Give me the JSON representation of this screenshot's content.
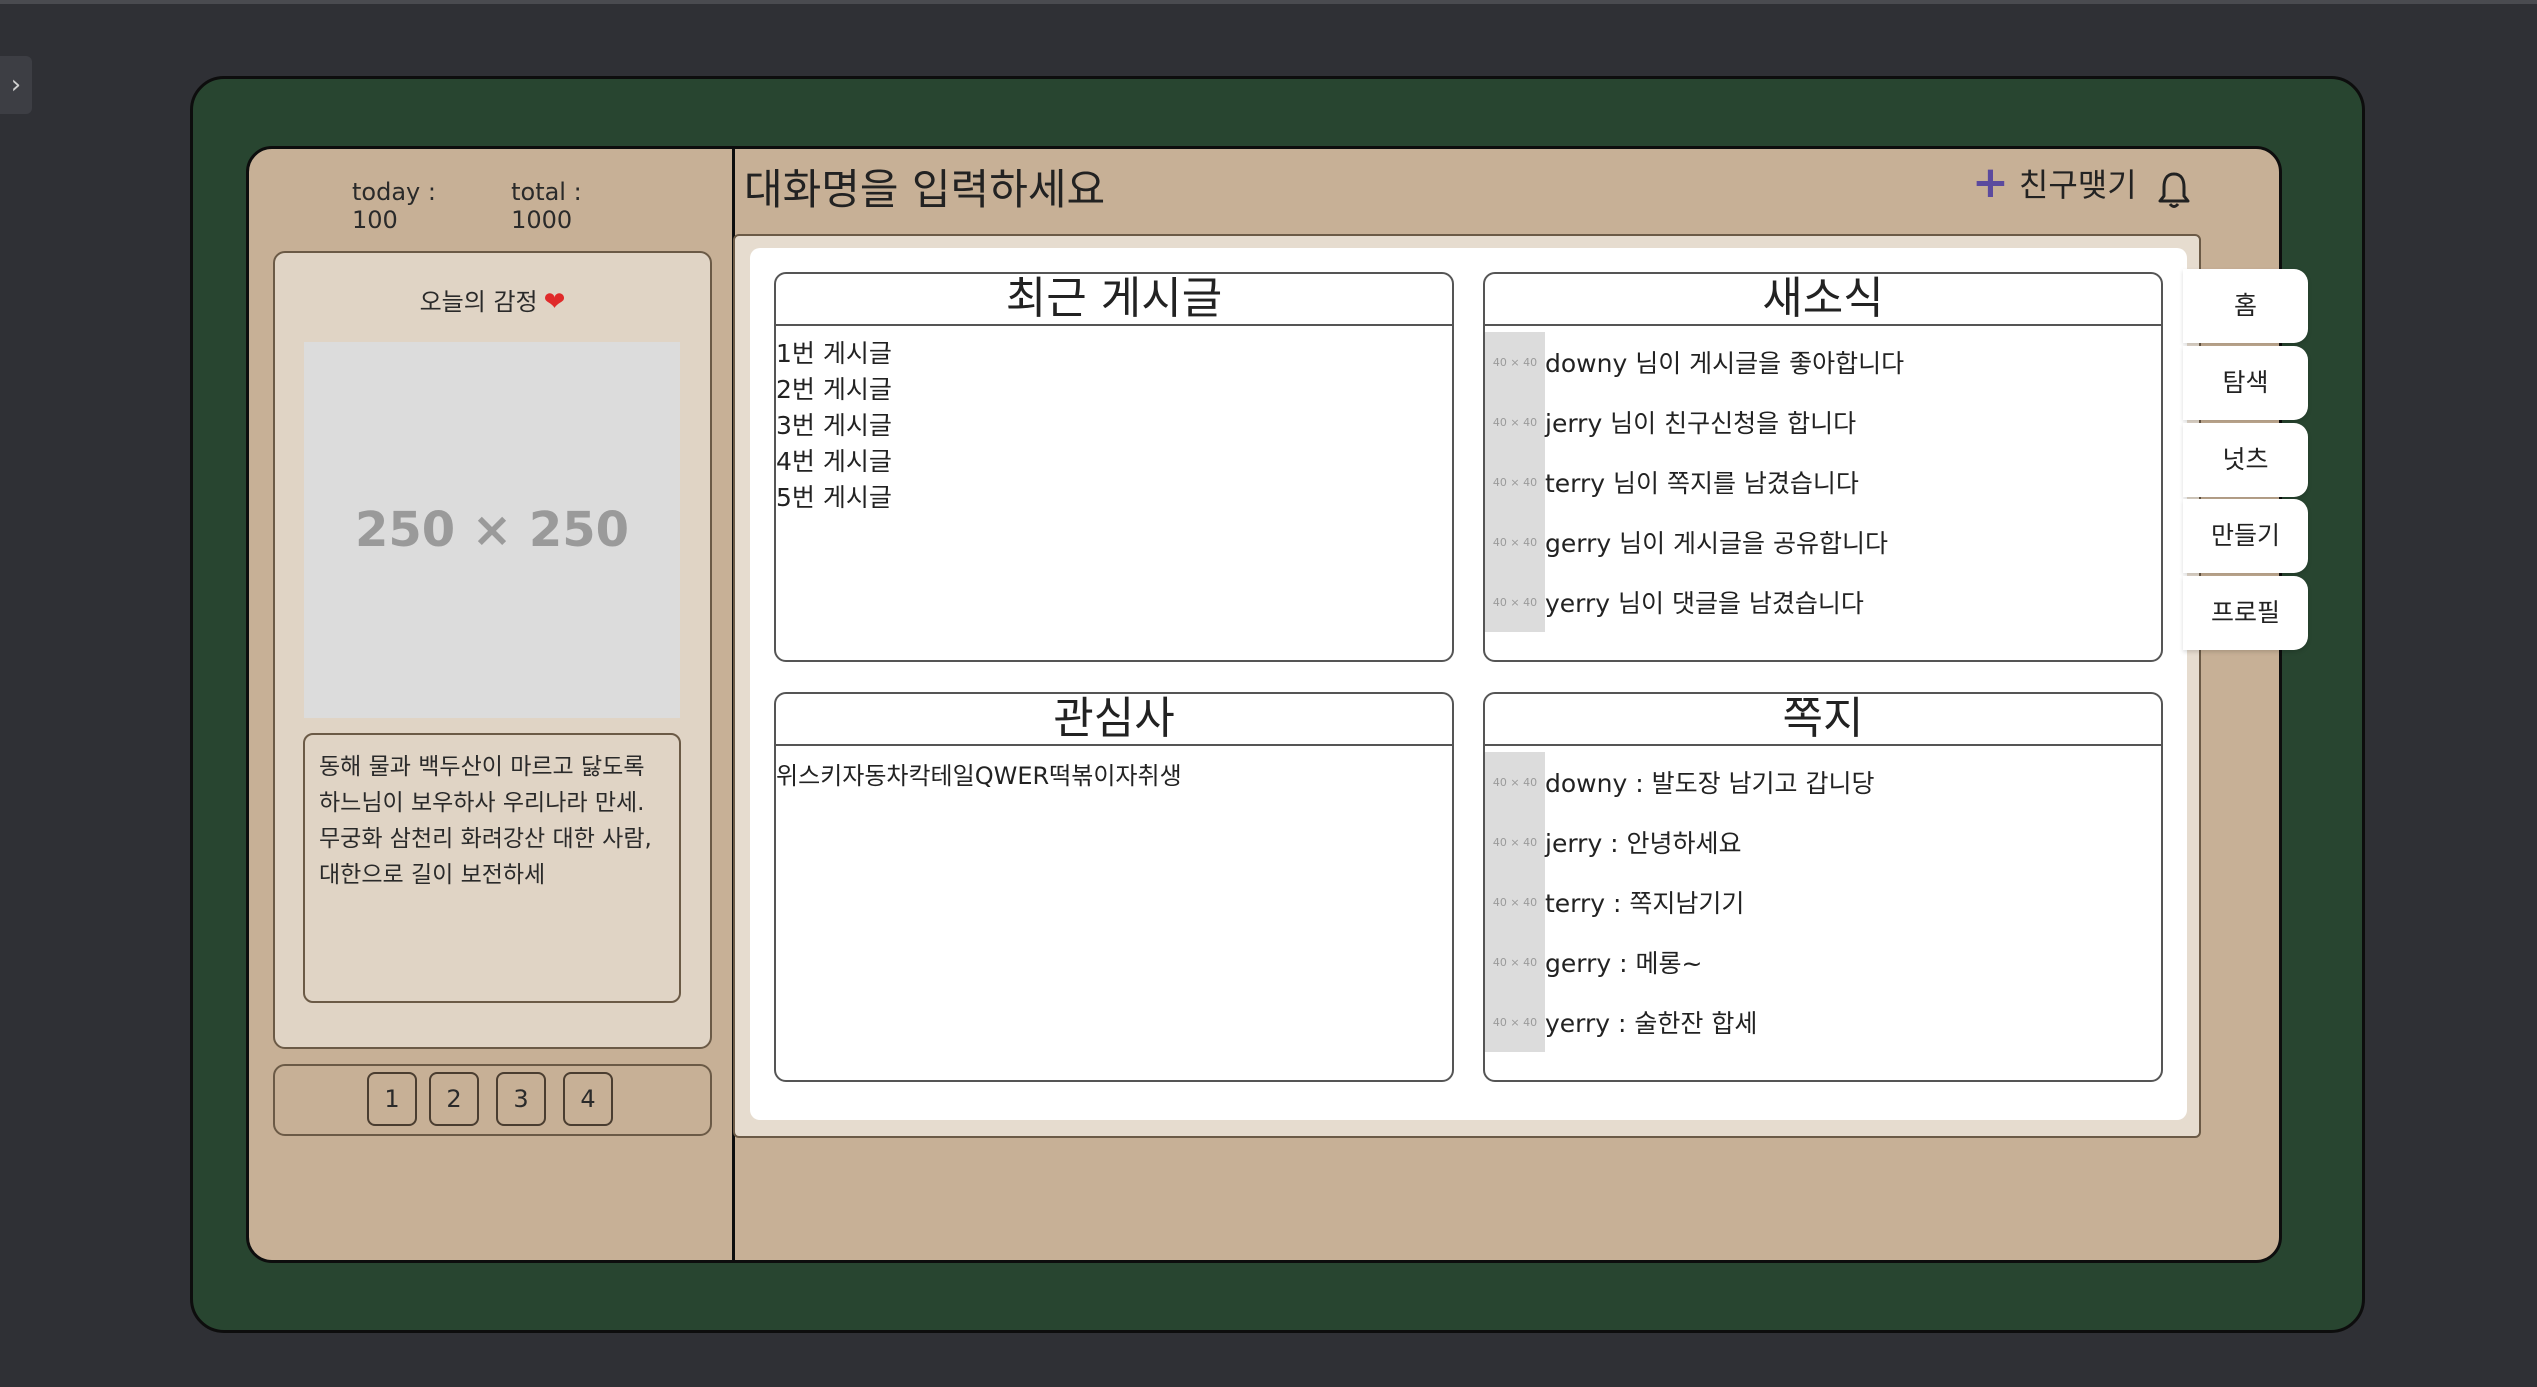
{
  "counter": {
    "today": "today : 100",
    "total": "total : 1000"
  },
  "mood": {
    "title": "오늘의 감정",
    "image_placeholder": "250 × 250",
    "bio": "동해 물과 백두산이 마르고 닳도록 하느님이 보우하사 우리나라 만세. 무궁화 삼천리 화려강산 대한 사람, 대한으로 길이 보전하세"
  },
  "pager": [
    "1",
    "2",
    "3",
    "4"
  ],
  "header": {
    "room_title": "대화명을 입력하세요",
    "friend_button": "친구맺기"
  },
  "recent_posts": {
    "title": "최근 게시글",
    "items": [
      "1번 게시글",
      "2번 게시글",
      "3번 게시글",
      "4번 게시글",
      "5번 게시글"
    ]
  },
  "news": {
    "title": "새소식",
    "avatar_label": "40 × 40",
    "items": [
      "downy 님이 게시글을 좋아합니다",
      "jerry 님이 친구신청을 합니다",
      "terry 님이 쪽지를 남겼습니다",
      "gerry 님이 게시글을 공유합니다",
      "yerry 님이 댓글을 남겼습니다"
    ]
  },
  "interests": {
    "title": "관심사",
    "text": "위스키자동차칵테일QWER떡볶이자취생"
  },
  "messages": {
    "title": "쪽지",
    "avatar_label": "40 × 40",
    "items": [
      "downy : 발도장 남기고 갑니당",
      "jerry : 안녕하세요",
      "terry : 쪽지남기기",
      "gerry : 메롱~",
      "yerry : 술한잔 합세"
    ]
  },
  "nav": [
    "홈",
    "탐색",
    "넛츠",
    "만들기",
    "프로필"
  ],
  "colors": {
    "frame": "#284530",
    "page": "#c7b096",
    "panel": "#e0d4c5",
    "accent": "#5b4a9e",
    "heart": "#e02a2a"
  },
  "icons": {
    "collapse": "chevron-right-icon",
    "mood": "heart-icon",
    "friend": "plus-icon",
    "alert": "bell-icon"
  }
}
